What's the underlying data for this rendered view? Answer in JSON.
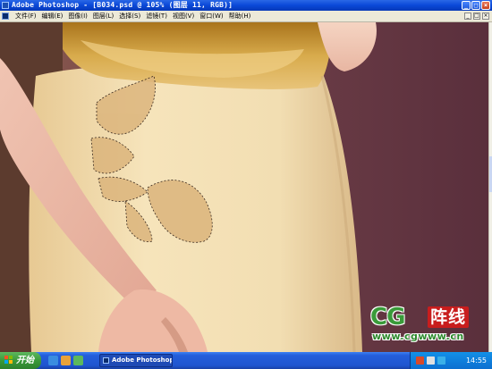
{
  "window": {
    "title": "Adobe Photoshop - [B034.psd @ 105% (图层 11, RGB)]",
    "controls": [
      "_",
      "□",
      "×"
    ]
  },
  "menu": {
    "items": [
      "文件(F)",
      "编辑(E)",
      "图像(I)",
      "图层(L)",
      "选择(S)",
      "滤镜(T)",
      "视图(V)",
      "窗口(W)",
      "帮助(H)"
    ],
    "mdi_controls": [
      "_",
      "□",
      "×"
    ]
  },
  "watermark": {
    "logo_text": "CG",
    "chinese_text": "阵线",
    "url": "www.cgwww.cn"
  },
  "taskbar": {
    "start_label": "开始",
    "task_label": "Adobe Photoshop",
    "clock": "14:55"
  },
  "colors": {
    "titlebar": "#0a48d8",
    "background_wall": "#6a3a46",
    "dress": "#f3dfb2",
    "gold_fabric": "#c8962e",
    "start_green": "#3a9a3a",
    "watermark_red": "#c81d1d"
  }
}
